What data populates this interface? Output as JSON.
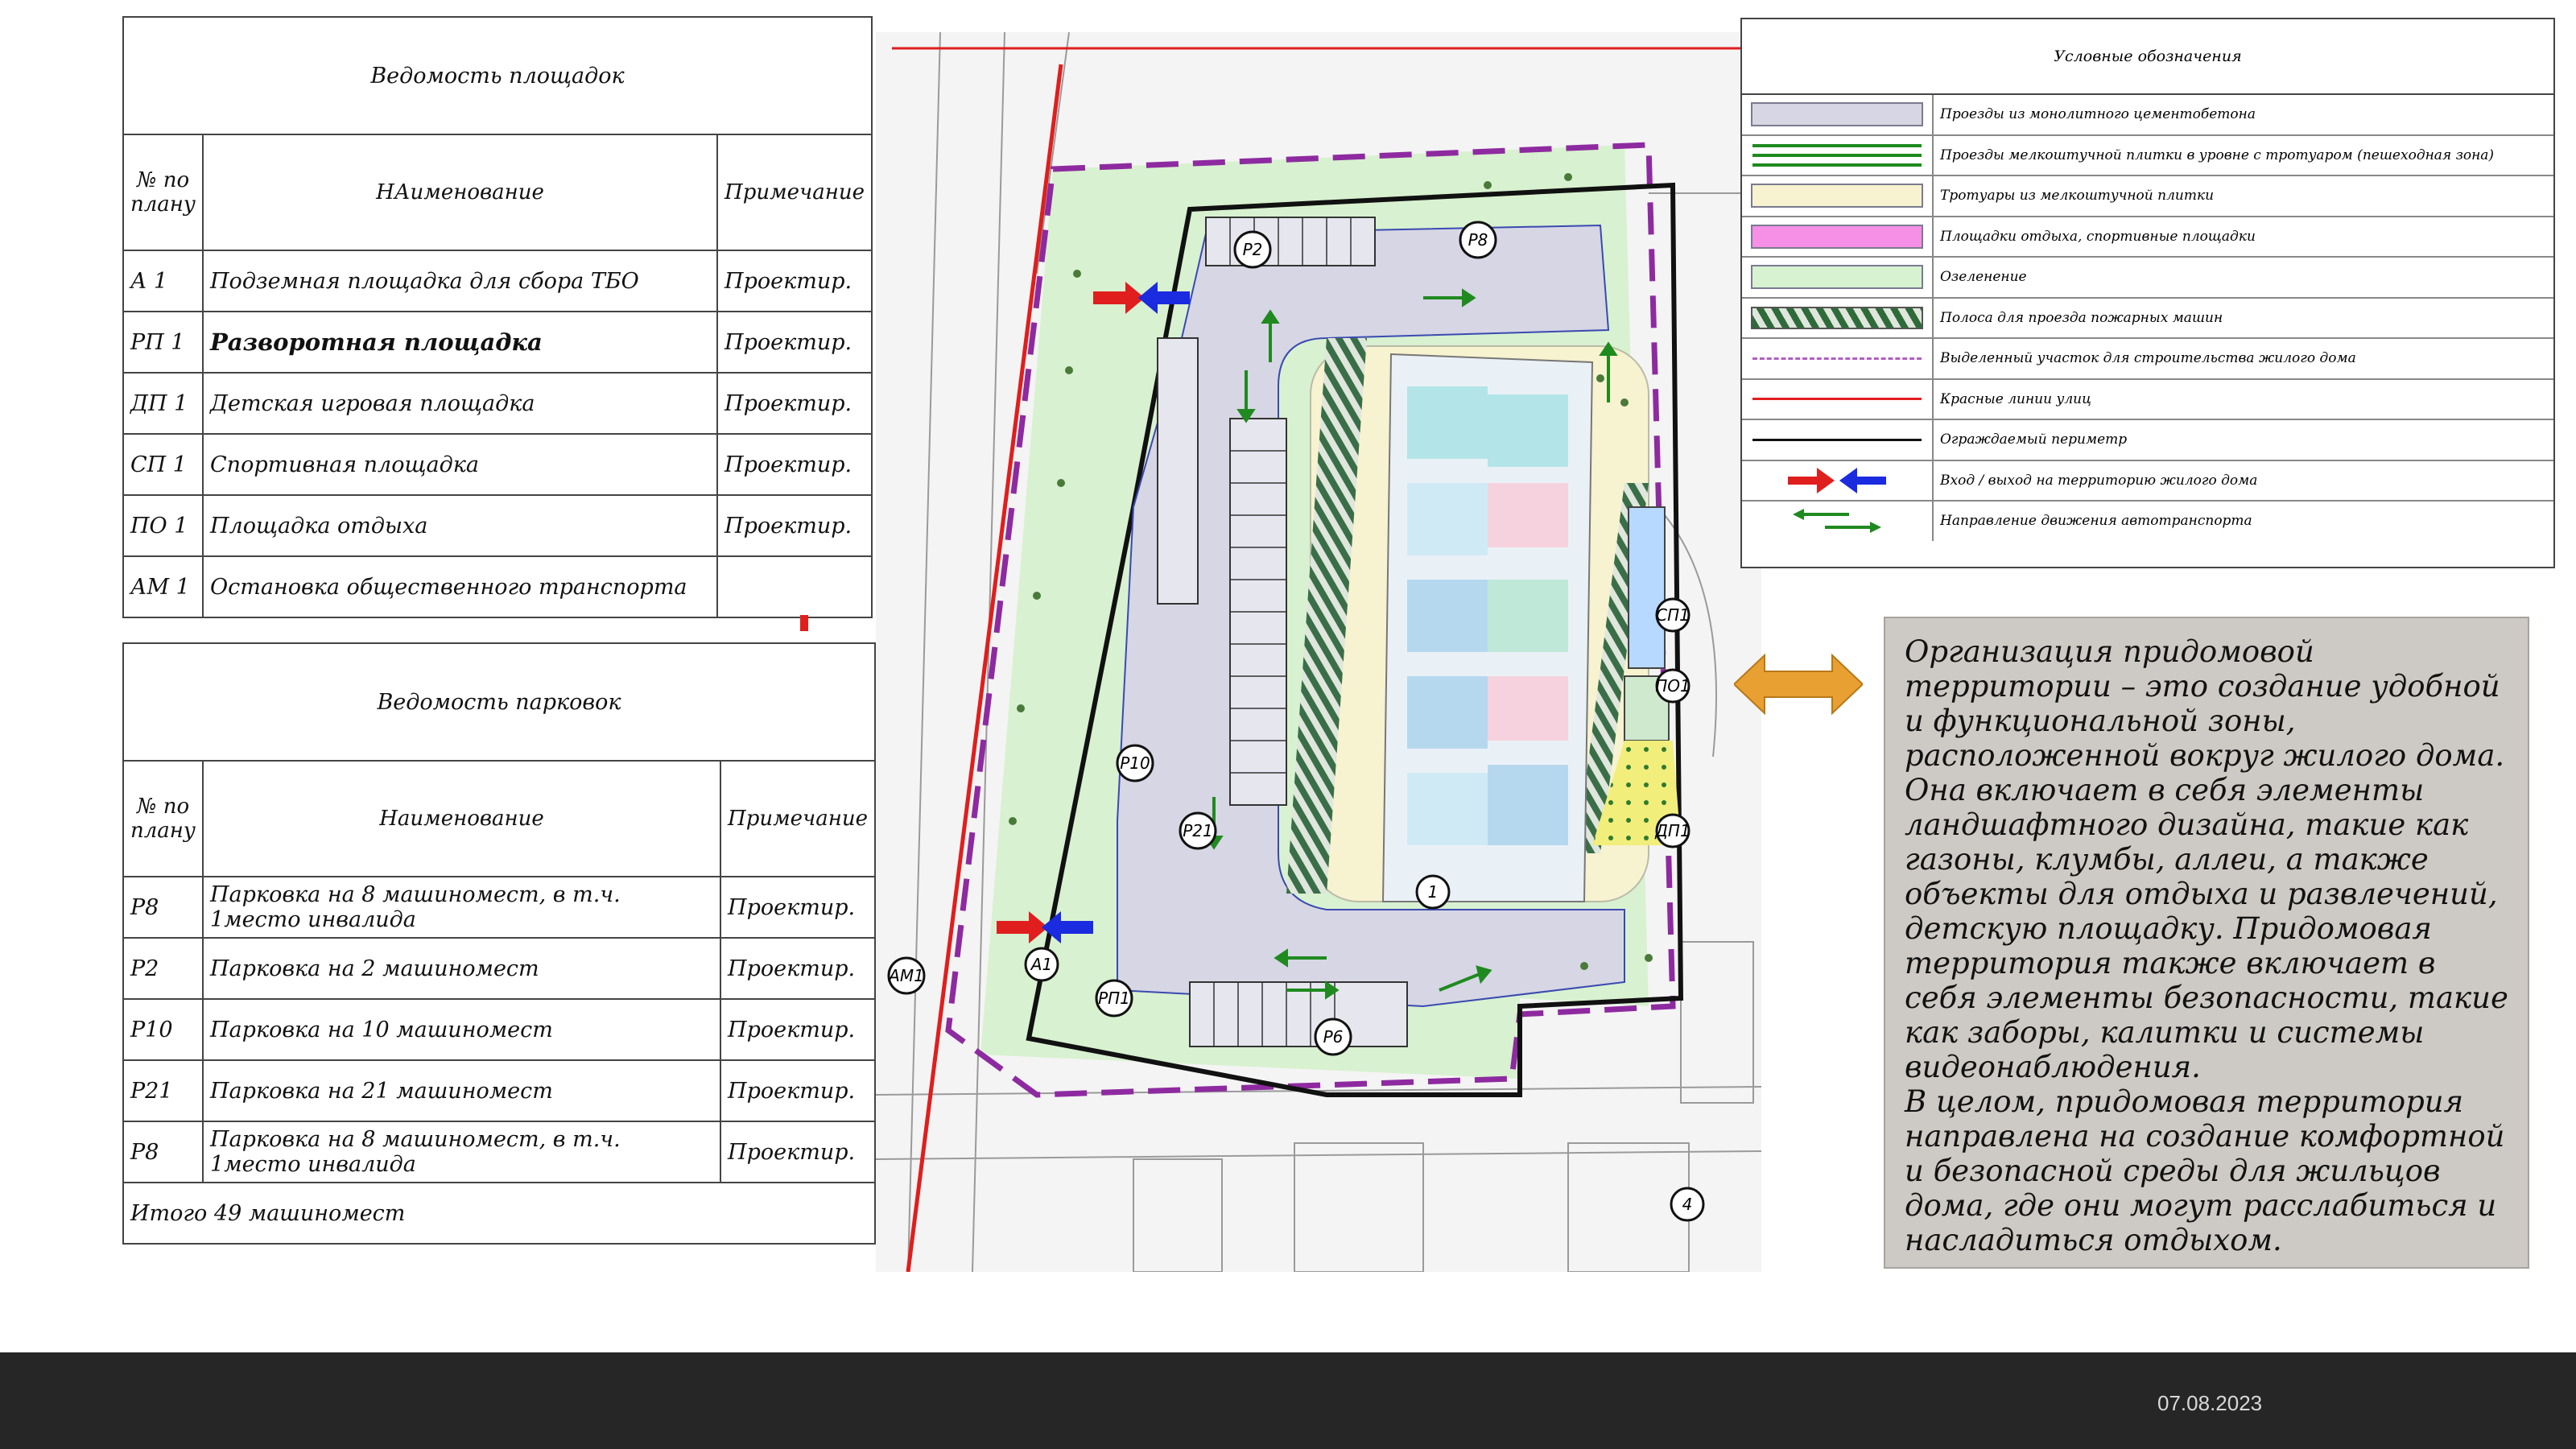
{
  "sites_table": {
    "title": "Ведомость площадок",
    "headers": [
      "№ по плану",
      "НАименование",
      "Примечание"
    ],
    "rows": [
      {
        "no": "А 1",
        "name": "Подземная площадка для сбора ТБО",
        "note": "Проектир.",
        "bold": false
      },
      {
        "no": "РП 1",
        "name": "Разворотная площадка",
        "note": "Проектир.",
        "bold": true
      },
      {
        "no": "ДП 1",
        "name": "Детская игровая площадка",
        "note": "Проектир.",
        "bold": false
      },
      {
        "no": "СП 1",
        "name": "Спортивная площадка",
        "note": "Проектир.",
        "bold": false
      },
      {
        "no": "ПО 1",
        "name": "Площадка отдыха",
        "note": "Проектир.",
        "bold": false
      },
      {
        "no": "АМ 1",
        "name": "Остановка общественного транспорта",
        "note": "",
        "bold": false
      }
    ]
  },
  "parking_table": {
    "title": "Ведомость парковок",
    "headers": [
      "№ по плану",
      "Наименование",
      "Примечание"
    ],
    "rows": [
      {
        "no": "Р8",
        "name": "Парковка на 8 машиномест, в т.ч. 1место инвалида",
        "note": "Проектир."
      },
      {
        "no": "Р2",
        "name": "Парковка на 2 машиномест",
        "note": "Проектир."
      },
      {
        "no": "Р10",
        "name": "Парковка на 10 машиномест",
        "note": "Проектир."
      },
      {
        "no": "Р21",
        "name": "Парковка на 21 машиномест",
        "note": "Проектир."
      },
      {
        "no": "Р8",
        "name": "Парковка на 8 машиномест, в т.ч. 1место инвалида",
        "note": "Проектир."
      }
    ],
    "total": "Итого 49 машиномест"
  },
  "legend": {
    "title": "Условные обозначения",
    "items": [
      {
        "label": "Проезды из монолитного цементобетона",
        "type": "fill",
        "color": "#d6d6e4"
      },
      {
        "label": "Проезды мелкоштучной плитки в уровне с тротуаром (пешеходная зона)",
        "type": "green-lines",
        "color": "#1f8a1f"
      },
      {
        "label": "Тротуары из мелкоштучной плитки",
        "type": "fill",
        "color": "#f7f2cf"
      },
      {
        "label": "Площадки отдыха, спортивные площадки",
        "type": "fill",
        "color": "#f590e6"
      },
      {
        "label": "Озеленение",
        "type": "fill",
        "color": "#d6f2d0"
      },
      {
        "label": "Полоса для проезда пожарных машин",
        "type": "hatch",
        "color": "#2f6b3a"
      },
      {
        "label": "Выделенный участок для строительства жилого дома",
        "type": "dash",
        "color": "#b060c0"
      },
      {
        "label": "Красные линии улиц",
        "type": "line",
        "color": "#e01e1e"
      },
      {
        "label": "Ограждаемый периметр",
        "type": "line",
        "color": "#111111"
      },
      {
        "label": "Вход / выход на территорию жилого дома",
        "type": "arrows-rb",
        "color": "#e01e1e"
      },
      {
        "label": "Направление движения автотранспорта",
        "type": "arrows-green",
        "color": "#1f8a1f"
      }
    ]
  },
  "plan": {
    "markers": [
      "Р2",
      "Р8",
      "Р10",
      "Р21",
      "Р6",
      "РП1",
      "А1",
      "АМ1",
      "СП1",
      "ПО1",
      "ДП1",
      "1",
      "4",
      "4"
    ]
  },
  "description": "Организация придомовой территории – это создание удобной и функциональной зоны, расположенной вокруг жилого дома. Она включает в себя элементы ландшафтного дизайна, такие как газоны, клумбы, аллеи, а также объекты для отдыха и развлечений, детскую площадку. Придомовая территория также включает в себя элементы безопасности, такие как заборы, калитки и системы видеонаблюдения.\nВ целом, придомовая территория направлена на создание комфортной и безопасной среды для жильцов дома, где они могут расслабиться и насладиться отдыхом.",
  "footer": {
    "date": "07.08.2023"
  },
  "colors": {
    "accent_orange": "#e8a032",
    "footer_bg": "#262626",
    "text_panel": "#cdc9c4"
  }
}
